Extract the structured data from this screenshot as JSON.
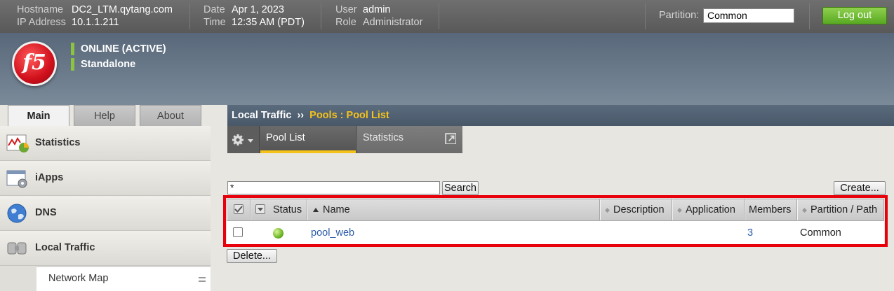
{
  "topbar": {
    "hostname_label": "Hostname",
    "hostname": "DC2_LTM.qytang.com",
    "ip_label": "IP Address",
    "ip": "10.1.1.211",
    "date_label": "Date",
    "date": "Apr 1, 2023",
    "time_label": "Time",
    "time": "12:35 AM (PDT)",
    "user_label": "User",
    "user": "admin",
    "role_label": "Role",
    "role": "Administrator",
    "partition_label": "Partition:",
    "partition_value": "Common",
    "logout_label": "Log out"
  },
  "banner": {
    "logo_text": "f5",
    "status": "ONLINE (ACTIVE)",
    "mode": "Standalone"
  },
  "left_tabs": [
    {
      "label": "Main",
      "active": true
    },
    {
      "label": "Help",
      "active": false
    },
    {
      "label": "About",
      "active": false
    }
  ],
  "sidebar": {
    "items": [
      {
        "label": "Statistics",
        "icon": "statistics-icon"
      },
      {
        "label": "iApps",
        "icon": "iapps-icon"
      },
      {
        "label": "DNS",
        "icon": "globe-icon"
      },
      {
        "label": "Local Traffic",
        "icon": "local-traffic-icon"
      }
    ],
    "sub_items": [
      {
        "label": "Network Map"
      }
    ]
  },
  "breadcrumb": {
    "root": "Local Traffic",
    "separator": "››",
    "current": "Pools : Pool List"
  },
  "content_tabs": [
    {
      "label": "Pool List",
      "active": true
    },
    {
      "label": "Statistics",
      "active": false
    }
  ],
  "search": {
    "value": "*",
    "button": "Search"
  },
  "create_button": "Create...",
  "delete_button": "Delete...",
  "table": {
    "columns": [
      "Status",
      "Name",
      "Description",
      "Application",
      "Members",
      "Partition / Path"
    ],
    "rows": [
      {
        "status": "available",
        "name": "pool_web",
        "description": "",
        "application": "",
        "members": "3",
        "partition": "Common"
      }
    ]
  },
  "colors": {
    "accent_yellow": "#f5c21a",
    "status_green": "#8bc53f",
    "highlight_red": "#e8000b",
    "link_blue": "#2a5ba8"
  }
}
